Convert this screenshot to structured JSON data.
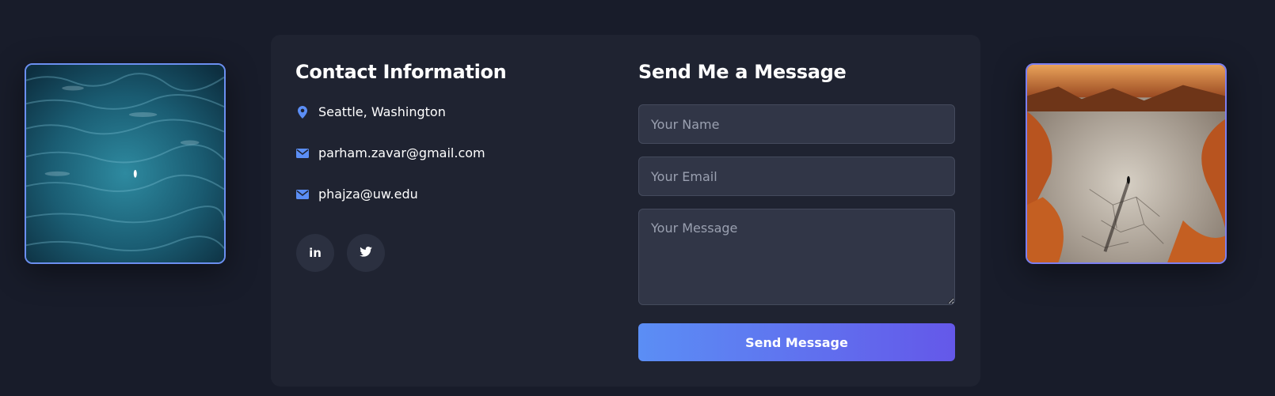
{
  "contact": {
    "title": "Contact Information",
    "items": [
      {
        "icon": "map-pin-icon",
        "text": "Seattle, Washington"
      },
      {
        "icon": "envelope-icon",
        "text": "parham.zavar@gmail.com"
      },
      {
        "icon": "envelope-icon",
        "text": "phajza@uw.edu"
      }
    ],
    "social": [
      {
        "icon": "linkedin-icon",
        "glyph": "in"
      },
      {
        "icon": "twitter-icon"
      }
    ]
  },
  "form": {
    "title": "Send Me a Message",
    "name_placeholder": "Your Name",
    "email_placeholder": "Your Email",
    "message_placeholder": "Your Message",
    "submit_label": "Send Message"
  },
  "photos": {
    "left": "ocean-aerial-image",
    "right": "desert-canyon-image"
  },
  "colors": {
    "background": "#181c2a",
    "card": "#1f2331",
    "accent": "#5b8ef5",
    "accent_end": "#6458e9",
    "icon": "#5b8ef5"
  }
}
